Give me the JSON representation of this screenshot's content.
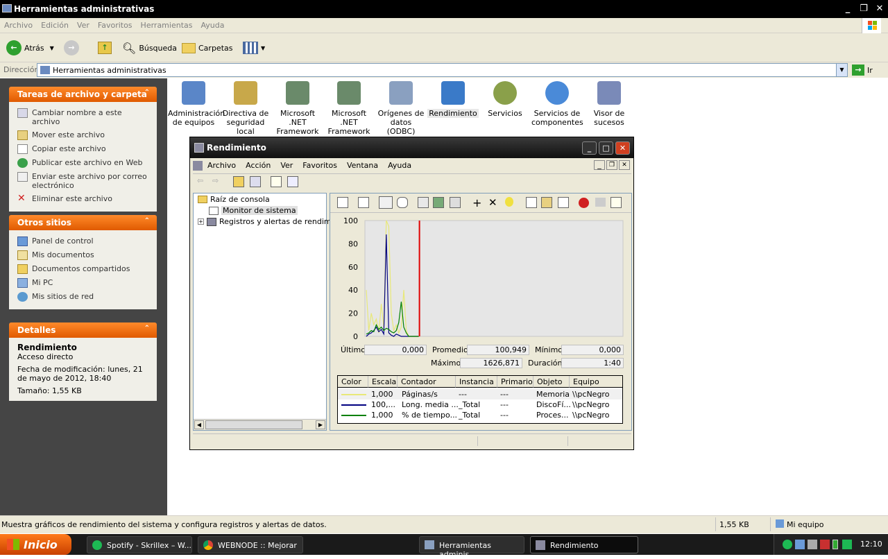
{
  "explorer": {
    "title": "Herramientas administrativas",
    "menu": [
      "Archivo",
      "Edición",
      "Ver",
      "Favoritos",
      "Herramientas",
      "Ayuda"
    ],
    "toolbar": {
      "back": "Atrás",
      "search": "Búsqueda",
      "folders": "Carpetas"
    },
    "address_label": "Dirección",
    "address_value": "Herramientas administrativas",
    "go_label": "Ir"
  },
  "sidebar": {
    "tasks": {
      "title": "Tareas de archivo y carpeta",
      "items": [
        "Cambiar nombre a este archivo",
        "Mover este archivo",
        "Copiar este archivo",
        "Publicar este archivo en Web",
        "Enviar este archivo por correo electrónico",
        "Eliminar este archivo"
      ]
    },
    "other": {
      "title": "Otros sitios",
      "items": [
        "Panel de control",
        "Mis documentos",
        "Documentos compartidos",
        "Mi PC",
        "Mis sitios de red"
      ]
    },
    "details": {
      "title": "Detalles",
      "name": "Rendimiento",
      "type": "Acceso directo",
      "modified": "Fecha de modificación: lunes, 21 de mayo de 2012, 18:40",
      "size": "Tamaño: 1,55 KB"
    }
  },
  "files": [
    {
      "label": "Administración de equipos",
      "color": "#5a86c8"
    },
    {
      "label": "Directiva de seguridad local",
      "color": "#c8a84a"
    },
    {
      "label": "Microsoft .NET Framework ...",
      "color": "#6a8a6a"
    },
    {
      "label": "Microsoft .NET Framework ...",
      "color": "#6a8a6a"
    },
    {
      "label": "Orígenes de datos (ODBC)",
      "color": "#8aa0c0"
    },
    {
      "label": "Rendimiento",
      "color": "#3a7ac8"
    },
    {
      "label": "Servicios",
      "color": "#8aa04a"
    },
    {
      "label": "Servicios de componentes",
      "color": "#4a8ad8"
    },
    {
      "label": "Visor de sucesos",
      "color": "#7a8ab8"
    }
  ],
  "status": {
    "text": "Muestra gráficos de rendimiento del sistema y configura registros y alertas de datos.",
    "size": "1,55 KB",
    "zone": "Mi equipo"
  },
  "taskbar": {
    "start": "Inicio",
    "buttons": [
      "Spotify - Skrillex – W...",
      "WEBNODE :: Mejorar ...",
      "Herramientas adminis...",
      "Rendimiento"
    ],
    "clock": "12:10"
  },
  "mmc": {
    "title": "Rendimiento",
    "menu": [
      "Archivo",
      "Acción",
      "Ver",
      "Favoritos",
      "Ventana",
      "Ayuda"
    ],
    "tree": [
      "Raíz de consola",
      "Monitor de sistema",
      "Registros y alertas de rendimie"
    ],
    "stats": {
      "last_label": "Último",
      "last": "0,000",
      "avg_label": "Promedio",
      "avg": "100,949",
      "min_label": "Mínimo",
      "min": "0,000",
      "max_label": "Máximo",
      "max": "1626,871",
      "dur_label": "Duración",
      "dur": "1:40"
    },
    "legend_headers": [
      "Color",
      "Escala",
      "Contador",
      "Instancia",
      "Primario",
      "Objeto",
      "Equipo"
    ],
    "legend_rows": [
      {
        "color": "#e8e878",
        "scale": "1,000",
        "counter": "Páginas/s",
        "instance": "---",
        "parent": "---",
        "object": "Memoria",
        "computer": "\\\\pcNegro"
      },
      {
        "color": "#000080",
        "scale": "100,...",
        "counter": "Long. media ...",
        "instance": "_Total",
        "parent": "---",
        "object": "DiscoFí...",
        "computer": "\\\\pcNegro"
      },
      {
        "color": "#008000",
        "scale": "1,000",
        "counter": "% de tiempo...",
        "instance": "_Total",
        "parent": "---",
        "object": "Proces...",
        "computer": "\\\\pcNegro"
      }
    ]
  },
  "chart_data": {
    "type": "line",
    "ylim": [
      0,
      100
    ],
    "yticks": [
      "100",
      "80",
      "60",
      "40",
      "20",
      "0"
    ],
    "x": [
      0,
      1,
      2,
      3,
      4,
      5,
      6,
      7,
      8,
      9,
      10,
      11,
      12,
      13,
      14,
      15,
      16,
      17,
      18,
      19,
      20,
      21
    ],
    "series": [
      {
        "name": "Páginas/s",
        "color": "#e8e878",
        "values": [
          40,
          5,
          20,
          10,
          15,
          3,
          28,
          8,
          100,
          95,
          20,
          5,
          10,
          3,
          8,
          40,
          5,
          0,
          0,
          0,
          0,
          0
        ]
      },
      {
        "name": "Long. media ...",
        "color": "#000080",
        "values": [
          0,
          2,
          3,
          5,
          8,
          4,
          6,
          2,
          88,
          3,
          1,
          0,
          2,
          1,
          0,
          0,
          0,
          0,
          0,
          0,
          0,
          0
        ]
      },
      {
        "name": "% de tiempo...",
        "color": "#008000",
        "values": [
          2,
          3,
          5,
          4,
          10,
          6,
          8,
          5,
          7,
          6,
          4,
          3,
          5,
          12,
          30,
          8,
          3,
          0,
          0,
          0,
          0,
          0
        ]
      }
    ]
  }
}
